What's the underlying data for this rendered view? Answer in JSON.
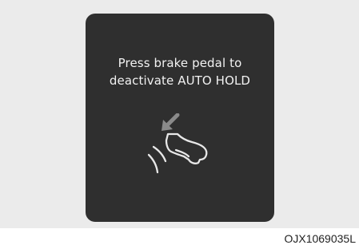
{
  "display": {
    "line1": "Press brake pedal to",
    "line2": "deactivate AUTO HOLD",
    "icon": "foot-press-brake-pedal-icon"
  },
  "figure_code": "OJX1069035L",
  "colors": {
    "background": "#ebebeb",
    "panel": "#2f2f2f",
    "text": "#f2f2f2",
    "arrow": "#8a8a8a",
    "icon_stroke": "#e8e8e8"
  }
}
